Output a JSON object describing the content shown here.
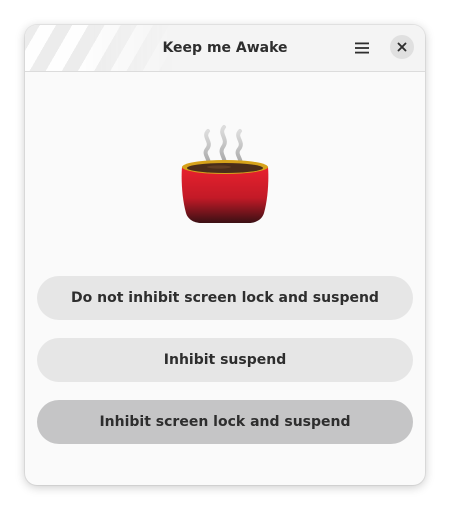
{
  "window": {
    "title": "Keep me Awake"
  },
  "header": {
    "menu_icon": "hamburger-menu-icon",
    "close_icon": "close-icon"
  },
  "illustration": {
    "icon": "steaming-coffee-cup-icon"
  },
  "options": [
    {
      "label": "Do not inhibit screen lock and suspend",
      "selected": false
    },
    {
      "label": "Inhibit suspend",
      "selected": false
    },
    {
      "label": "Inhibit screen lock and suspend",
      "selected": true
    }
  ],
  "colors": {
    "button_bg": "#e6e6e6",
    "button_selected_bg": "#c5c5c6",
    "cup_red": "#d41d2a",
    "cup_rim": "#d6a21a",
    "coffee": "#4a2d1a"
  }
}
